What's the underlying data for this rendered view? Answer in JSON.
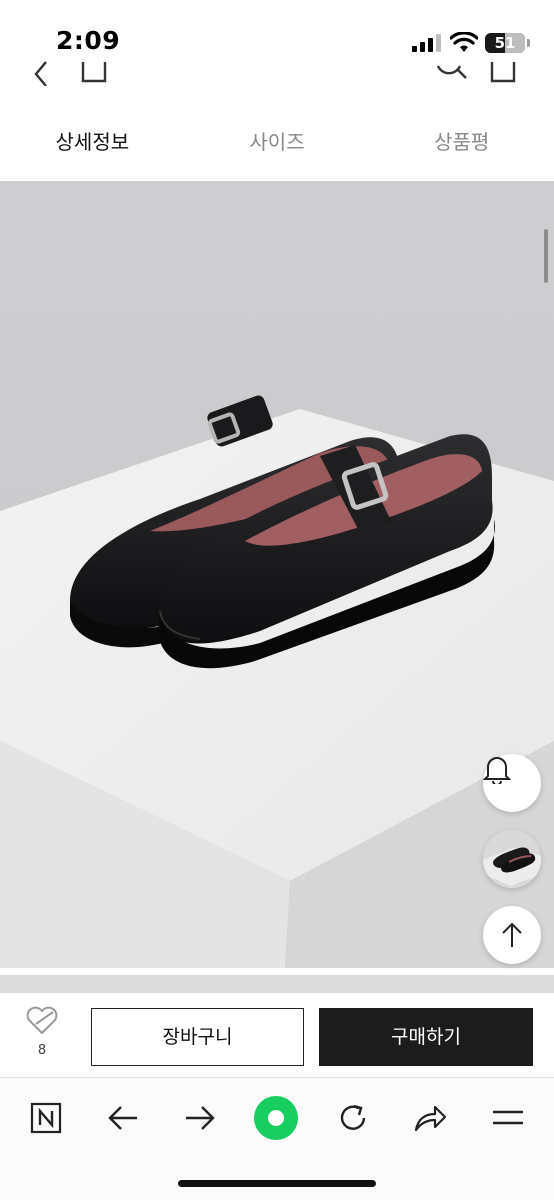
{
  "status_bar": {
    "time": "2:09",
    "battery_level": "51",
    "battery_fraction": 0.51
  },
  "tabs": [
    {
      "label": "상세정보",
      "active": true
    },
    {
      "label": "사이즈",
      "active": false
    },
    {
      "label": "상품평",
      "active": false
    }
  ],
  "product_image": {
    "description_icon": "black-leather-mary-jane-shoes-photo"
  },
  "floating_buttons": {
    "notify_icon": "bell-icon",
    "thumbnail_icon": "product-thumbnail",
    "top_icon": "arrow-up-icon"
  },
  "purchase_bar": {
    "wish_count": "8",
    "cart_label": "장바구니",
    "buy_label": "구매하기"
  },
  "browser_toolbar": {
    "items": [
      "naver-home-icon",
      "back-arrow-icon",
      "forward-arrow-icon",
      "green-dot-icon",
      "refresh-icon",
      "share-icon",
      "menu-icon"
    ],
    "accent_color": "#19ce60"
  }
}
